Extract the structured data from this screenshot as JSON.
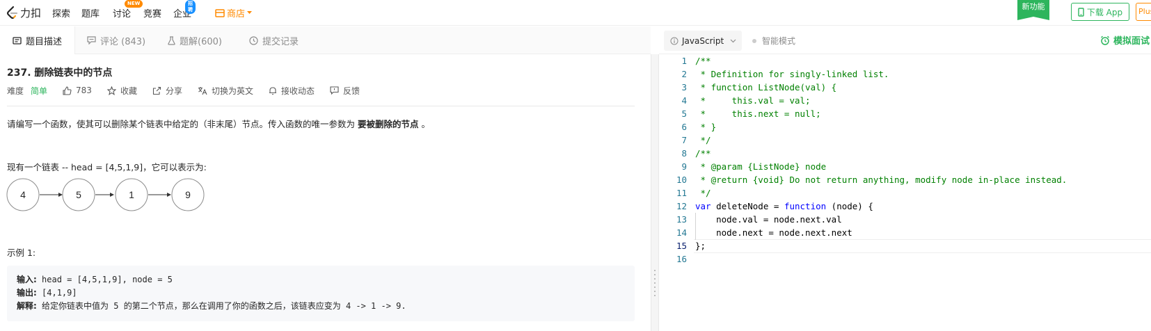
{
  "nav": {
    "logo_text": "力扣",
    "items": [
      "探索",
      "题库",
      "讨论",
      "竞赛",
      "企业"
    ],
    "discuss_badge": "NEW",
    "enterprise_badge": "招聘",
    "store": "商店",
    "new_feature": "新功能",
    "download": "下载 App",
    "plus": "Plus"
  },
  "tabs": {
    "description": "题目描述",
    "comments": "评论 (843)",
    "solutions": "题解(600)",
    "submissions": "提交记录"
  },
  "problem": {
    "title": "237. 删除链表中的节点",
    "difficulty_label": "难度",
    "difficulty": "简单",
    "likes": "783",
    "favorite": "收藏",
    "share": "分享",
    "switch_lang": "切换为英文",
    "subscribe": "接收动态",
    "feedback": "反馈",
    "desc_prefix": "请编写一个函数，使其可以删除某个链表中给定的（非末尾）节点。传入函数的唯一参数为 ",
    "desc_bold": "要被删除的节点",
    "desc_suffix": " 。",
    "para2": "现有一个链表 -- head = [4,5,1,9]，它可以表示为:",
    "nodes": [
      "4",
      "5",
      "1",
      "9"
    ],
    "example_title": "示例 1:",
    "example": {
      "input_label": "输入:",
      "input": " head = [4,5,1,9], node = 5",
      "output_label": "输出:",
      "output": " [4,1,9]",
      "explain_label": "解释:",
      "explain": " 给定你链表中值为 5 的第二个节点，那么在调用了你的函数之后，该链表应变为 4 -> 1 -> 9."
    }
  },
  "editor": {
    "language": "JavaScript",
    "smart_mode": "智能模式",
    "simulate": "模拟面试",
    "current_line": 15,
    "lines": [
      {
        "n": "1",
        "parts": [
          {
            "t": "/**",
            "c": "cm"
          }
        ]
      },
      {
        "n": "2",
        "parts": [
          {
            "t": " * Definition for singly-linked list.",
            "c": "cm"
          }
        ]
      },
      {
        "n": "3",
        "parts": [
          {
            "t": " * function ListNode(val) {",
            "c": "cm"
          }
        ]
      },
      {
        "n": "4",
        "parts": [
          {
            "t": " *     this.val = val;",
            "c": "cm"
          }
        ]
      },
      {
        "n": "5",
        "parts": [
          {
            "t": " *     this.next = null;",
            "c": "cm"
          }
        ]
      },
      {
        "n": "6",
        "parts": [
          {
            "t": " * }",
            "c": "cm"
          }
        ]
      },
      {
        "n": "7",
        "parts": [
          {
            "t": " */",
            "c": "cm"
          }
        ]
      },
      {
        "n": "8",
        "parts": [
          {
            "t": "/**",
            "c": "cm"
          }
        ]
      },
      {
        "n": "9",
        "parts": [
          {
            "t": " * @param {ListNode} node",
            "c": "cm"
          }
        ]
      },
      {
        "n": "10",
        "parts": [
          {
            "t": " * @return {void} Do not return anything, modify node in-place instead.",
            "c": "cm"
          }
        ]
      },
      {
        "n": "11",
        "parts": [
          {
            "t": " */",
            "c": "cm"
          }
        ]
      },
      {
        "n": "12",
        "parts": [
          {
            "t": "var",
            "c": "kw"
          },
          {
            "t": " deleteNode = ",
            "c": ""
          },
          {
            "t": "function",
            "c": "kw"
          },
          {
            "t": " (node) {",
            "c": ""
          }
        ]
      },
      {
        "n": "13",
        "parts": [
          {
            "t": "    node.val = node.next.val",
            "c": ""
          }
        ]
      },
      {
        "n": "14",
        "parts": [
          {
            "t": "    node.next = node.next.next",
            "c": ""
          }
        ]
      },
      {
        "n": "15",
        "parts": [
          {
            "t": "};",
            "c": ""
          }
        ]
      },
      {
        "n": "16",
        "parts": [
          {
            "t": "",
            "c": ""
          }
        ]
      }
    ]
  },
  "colors": {
    "accent_green": "#2db55d",
    "accent_orange": "#ff8a00",
    "comment": "#008000",
    "keyword": "#0000ff"
  }
}
